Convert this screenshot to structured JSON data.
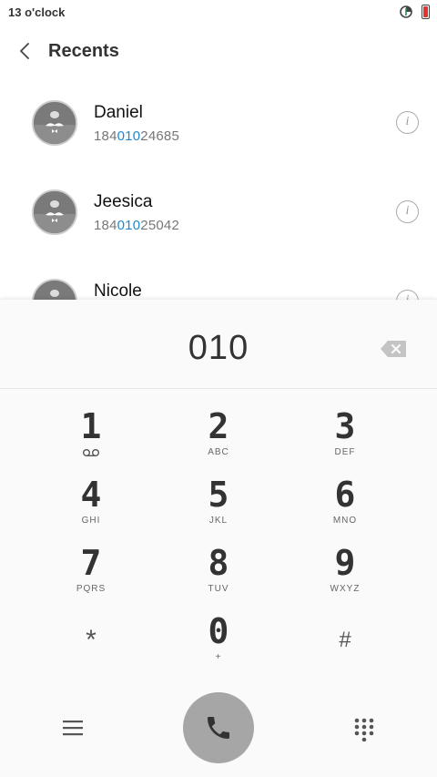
{
  "status": {
    "time": "13 o'clock",
    "battery_color": "#e2342c"
  },
  "header": {
    "title": "Recents"
  },
  "contacts": [
    {
      "name": "Daniel",
      "number_pre": "184",
      "number_match": "010",
      "number_post": "24685"
    },
    {
      "name": "Jeesica",
      "number_pre": "184",
      "number_match": "010",
      "number_post": "25042"
    },
    {
      "name": "Nicole",
      "number_pre": "",
      "number_match": "",
      "number_post": ""
    }
  ],
  "dialer": {
    "input": "010",
    "keys": [
      {
        "digit": "1",
        "letters": ""
      },
      {
        "digit": "2",
        "letters": "ABC"
      },
      {
        "digit": "3",
        "letters": "DEF"
      },
      {
        "digit": "4",
        "letters": "GHI"
      },
      {
        "digit": "5",
        "letters": "JKL"
      },
      {
        "digit": "6",
        "letters": "MNO"
      },
      {
        "digit": "7",
        "letters": "PQRS"
      },
      {
        "digit": "8",
        "letters": "TUV"
      },
      {
        "digit": "9",
        "letters": "WXYZ"
      },
      {
        "digit": "*",
        "letters": ""
      },
      {
        "digit": "0",
        "letters": "+"
      },
      {
        "digit": "#",
        "letters": ""
      }
    ]
  },
  "accent_color": "#1e88d0"
}
